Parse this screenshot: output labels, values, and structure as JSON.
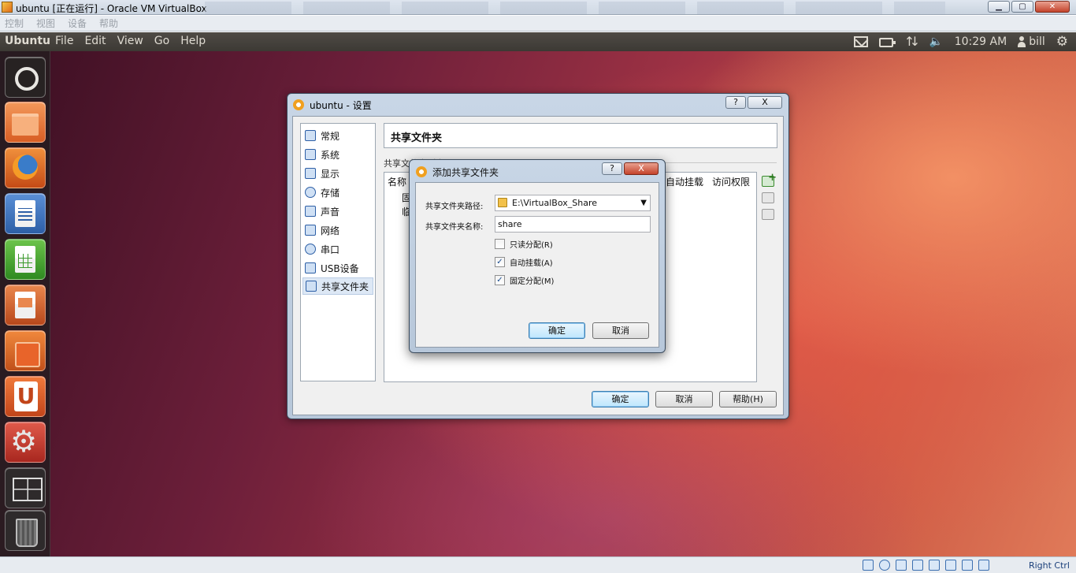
{
  "host_window": {
    "title": "ubuntu [正在运行] - Oracle VM VirtualBox",
    "menu": [
      "控制",
      "视图",
      "设备",
      "帮助"
    ]
  },
  "ubuntu_panel": {
    "brand": "Ubuntu",
    "menus": [
      "File",
      "Edit",
      "View",
      "Go",
      "Help"
    ],
    "time": "10:29 AM",
    "user": "bill"
  },
  "launcher": {
    "items": [
      "dash-home",
      "files",
      "firefox",
      "writer",
      "calc",
      "impress",
      "software-center",
      "ubuntu-one",
      "system-settings",
      "workspace-switcher",
      "trash"
    ]
  },
  "settings_dialog": {
    "title": "ubuntu - 设置",
    "help_btn": "?",
    "close_btn": "X",
    "nav": [
      "常规",
      "系统",
      "显示",
      "存储",
      "声音",
      "网络",
      "串口",
      "USB设备",
      "共享文件夹"
    ],
    "content_title": "共享文件夹",
    "section_label": "共享文件夹列表",
    "columns": [
      "名称",
      "自动挂载",
      "访问权限"
    ],
    "rows": [
      "固",
      "临"
    ],
    "ok": "确定",
    "cancel": "取消",
    "help": "帮助(H)"
  },
  "add_share_dialog": {
    "title": "添加共享文件夹",
    "help_btn": "?",
    "close_btn": "X",
    "path_label": "共享文件夹路径:",
    "path_value": "E:\\VirtualBox_Share",
    "name_label": "共享文件夹名称:",
    "name_value": "share",
    "checkboxes": [
      {
        "label": "只读分配(R)",
        "checked": false
      },
      {
        "label": "自动挂载(A)",
        "checked": true
      },
      {
        "label": "固定分配(M)",
        "checked": true
      }
    ],
    "ok": "确定",
    "cancel": "取消"
  },
  "status_bar": {
    "host_key": "Right Ctrl"
  },
  "colors": {
    "panel": "#3c3934",
    "accent_orange": "#e06a1b",
    "dialog_frame": "#b7c7da"
  }
}
